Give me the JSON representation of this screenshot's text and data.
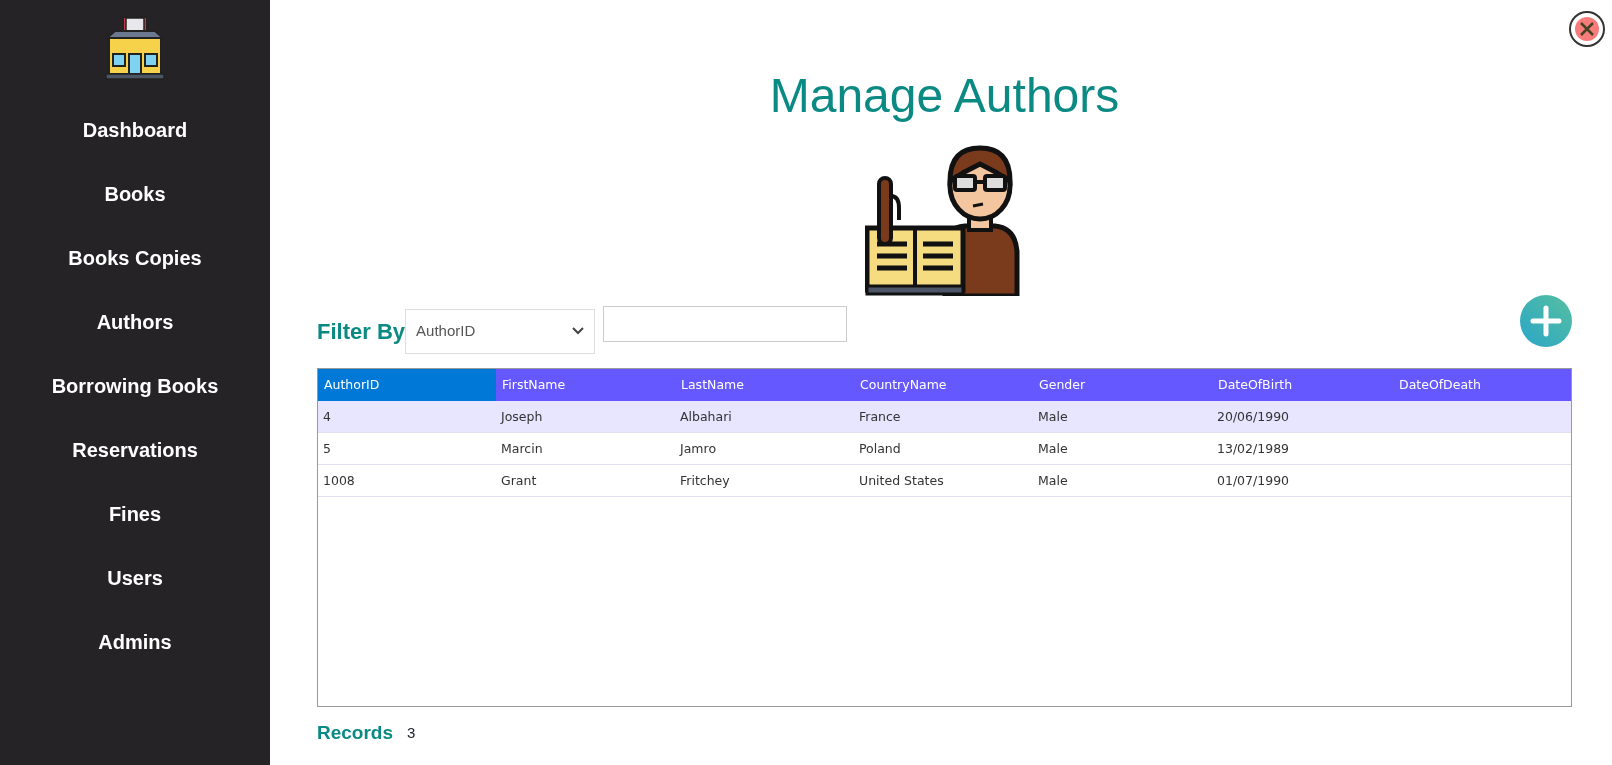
{
  "sidebar": {
    "items": [
      {
        "label": "Dashboard",
        "selected": false
      },
      {
        "label": "Books",
        "selected": false
      },
      {
        "label": "Books Copies",
        "selected": false
      },
      {
        "label": "Authors",
        "selected": false
      },
      {
        "label": "Borrowing Books",
        "selected": false
      },
      {
        "label": "Reservations",
        "selected": false
      },
      {
        "label": "Fines",
        "selected": false
      },
      {
        "label": "Users",
        "selected": false
      },
      {
        "label": "Admins",
        "selected": false
      }
    ]
  },
  "title": "Manage Authors",
  "filter": {
    "label": "Filter By",
    "dropdown_value": "AuthorID"
  },
  "table": {
    "columns": [
      {
        "label": "AuthorID",
        "selected": true
      },
      {
        "label": "FirstName",
        "selected": false
      },
      {
        "label": "LastName",
        "selected": false
      },
      {
        "label": "CountryName",
        "selected": false
      },
      {
        "label": "Gender",
        "selected": false
      },
      {
        "label": "DateOfBirth",
        "selected": false
      },
      {
        "label": "DateOfDeath",
        "selected": false
      }
    ],
    "rows": [
      {
        "selected": true,
        "cells": [
          "4",
          "Joseph",
          "Albahari",
          "France",
          "Male",
          "20/06/1990"
        ]
      },
      {
        "selected": false,
        "cells": [
          "5",
          "Marcin",
          "Jamro",
          "Poland",
          "Male",
          "13/02/1989"
        ]
      },
      {
        "selected": false,
        "cells": [
          "1008",
          "Grant",
          "Fritchey",
          "United States",
          "Male",
          "01/07/1990"
        ]
      }
    ]
  },
  "records": {
    "label": "Records",
    "count": "3"
  }
}
